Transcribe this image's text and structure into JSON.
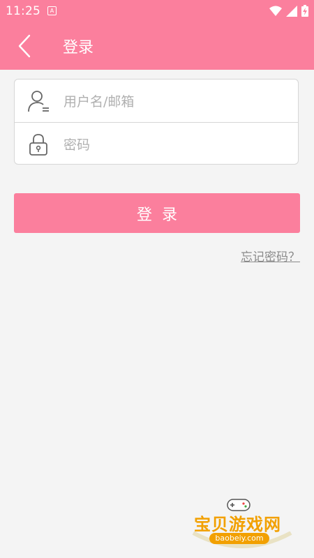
{
  "status_bar": {
    "time": "11:25",
    "notification_icon": "a-notification-icon",
    "icons": [
      "wifi-icon",
      "signal-icon",
      "battery-charging-icon"
    ]
  },
  "app_bar": {
    "title": "登录",
    "back_icon": "chevron-left-icon",
    "color": "#fb7f9d"
  },
  "form": {
    "username": {
      "placeholder": "用户名/邮箱",
      "value": "",
      "icon": "user-icon"
    },
    "password": {
      "placeholder": "密码",
      "value": "",
      "icon": "lock-icon"
    }
  },
  "login_button": {
    "label": "登录",
    "color": "#fb7f9d"
  },
  "forgot_link": "忘记密码？",
  "watermark": {
    "text": "宝贝游戏网",
    "url": "baobeiy.com"
  }
}
